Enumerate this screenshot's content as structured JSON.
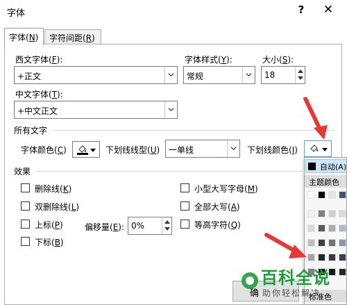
{
  "dialog": {
    "title": "字体",
    "help": "?",
    "close": "✕"
  },
  "tabs": [
    {
      "label": "字体(",
      "key": "N",
      "suffix": ")",
      "active": true
    },
    {
      "label": "字符间距(",
      "key": "R",
      "suffix": ")",
      "active": false
    }
  ],
  "latin_font": {
    "label": "西文字体(",
    "key": "F",
    "suffix": "):",
    "value": "+正文"
  },
  "font_style": {
    "label": "字体样式(",
    "key": "Y",
    "suffix": "):",
    "value": "常规"
  },
  "size": {
    "label": "大小(",
    "key": "S",
    "suffix": "):",
    "value": "18"
  },
  "asian_font": {
    "label": "中文字体(",
    "key": "T",
    "suffix": "):",
    "value": "+中文正文"
  },
  "all_text": {
    "heading": "所有文字",
    "font_color": {
      "label": "字体颜色(",
      "key": "C",
      "suffix": ")"
    },
    "underline_style": {
      "label": "下划线线型(",
      "key": "U",
      "suffix": ")",
      "value": "一单线"
    },
    "underline_color": {
      "label": "下划线颜色(",
      "key": "I",
      "suffix": ")"
    }
  },
  "effects": {
    "heading": "效果",
    "strikethrough": {
      "label": "删除线(",
      "key": "K",
      "suffix": ")"
    },
    "double_strikethrough": {
      "label": "双删除线(",
      "key": "L",
      "suffix": ")"
    },
    "superscript": {
      "label": "上标(",
      "key": "P",
      "suffix": ")"
    },
    "subscript": {
      "label": "下标(",
      "key": "B",
      "suffix": ")"
    },
    "offset": {
      "label": "偏移量(",
      "key": "E",
      "suffix": "):",
      "value": "0%"
    },
    "small_caps": {
      "label": "小型大写字母(",
      "key": "M",
      "suffix": ")"
    },
    "all_caps": {
      "label": "全部大写(",
      "key": "A",
      "suffix": ")"
    },
    "equalize_height": {
      "label": "等高字符(",
      "key": "Q",
      "suffix": ")"
    }
  },
  "color_popup": {
    "automatic": "自动(A)",
    "theme_colors": "主题颜色",
    "standard_colors": "标准色"
  },
  "ok_button": "确",
  "watermark": {
    "title": "百科全说",
    "subtitle": "助你轻松解决"
  },
  "colors": {
    "accent_red": "#e53935",
    "selection_bg": "#cde6f7",
    "watermark_green": "#1f9d3d"
  }
}
